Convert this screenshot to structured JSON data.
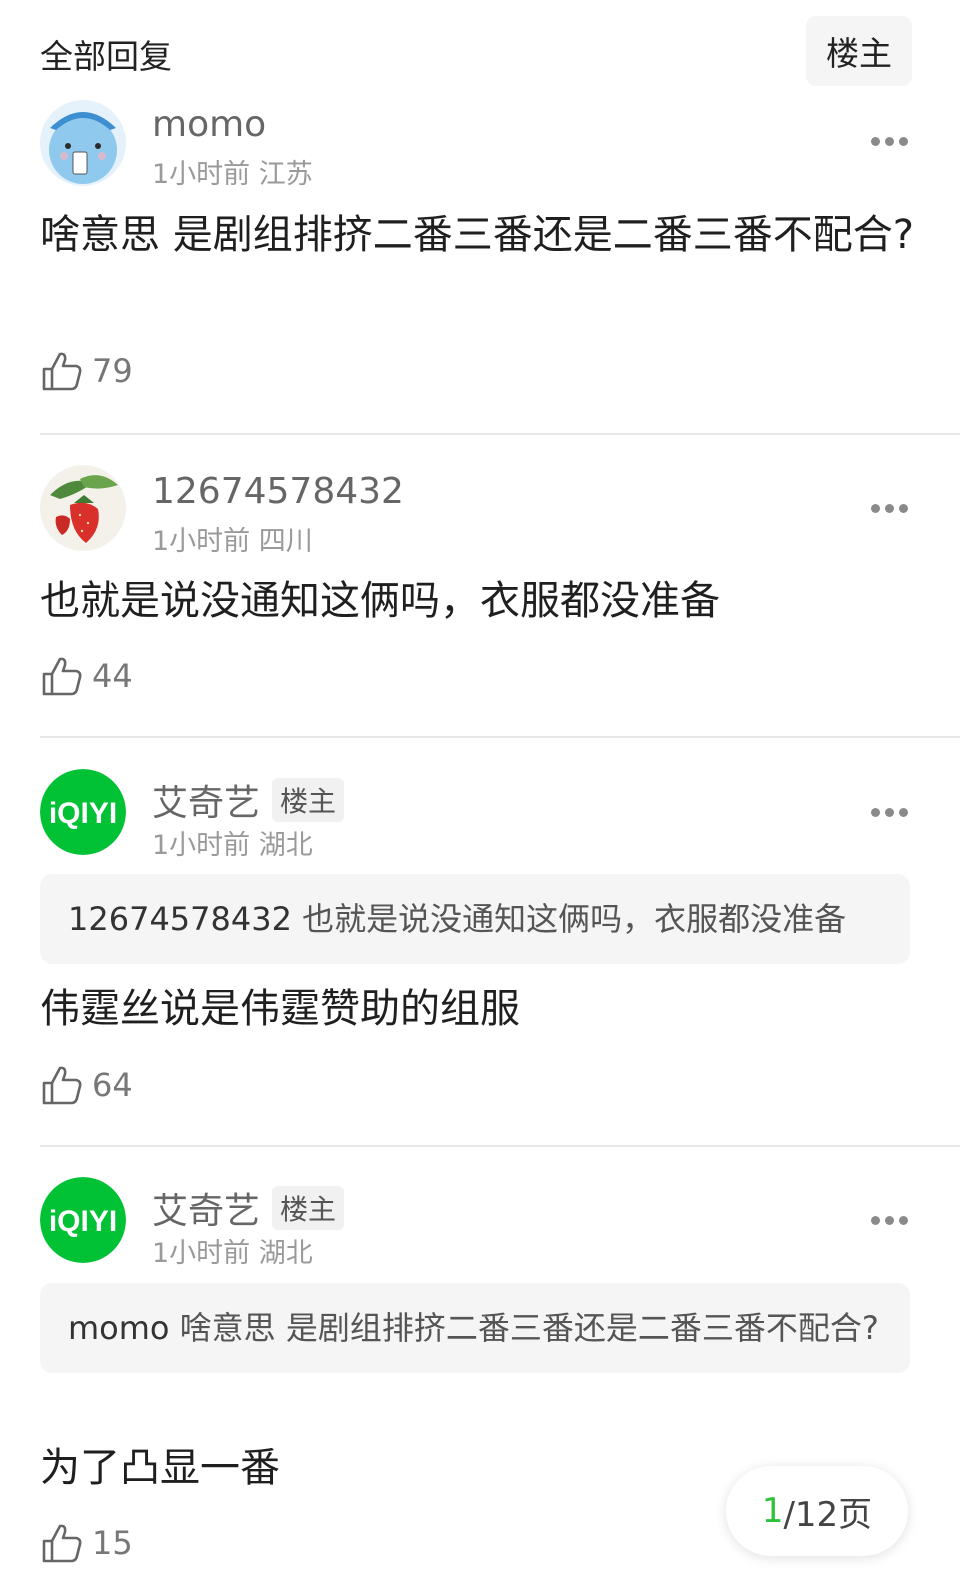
{
  "header": {
    "title": "全部回复",
    "op_filter_label": "楼主"
  },
  "comments": [
    {
      "username": "momo",
      "time": "1小时前",
      "location": "江苏",
      "text": "啥意思 是剧组排挤二番三番还是二番三番不配合?",
      "likes": "79",
      "avatar": "cartoon-avatar-icon"
    },
    {
      "username": "12674578432",
      "time": "1小时前",
      "location": "四川",
      "text": "也就是说没通知这俩吗，衣服都没准备",
      "likes": "44",
      "avatar": "strawberry-avatar-icon"
    },
    {
      "username": "艾奇艺",
      "badge": "楼主",
      "time": "1小时前",
      "location": "湖北",
      "quote": {
        "name": "12674578432",
        "text": "也就是说没通知这俩吗，衣服都没准备"
      },
      "text": "伟霆丝说是伟霆赞助的组服",
      "likes": "64",
      "avatar": "iqiyi-logo-avatar"
    },
    {
      "username": "艾奇艺",
      "badge": "楼主",
      "time": "1小时前",
      "location": "湖北",
      "quote": {
        "name": "momo",
        "text": "啥意思 是剧组排挤二番三番还是二番三番不配合?"
      },
      "text": "为了凸显一番",
      "likes": "15",
      "avatar": "iqiyi-logo-avatar"
    }
  ],
  "pager": {
    "current": "1",
    "total_label": "/12页"
  },
  "colors": {
    "brand_green": "#00c234",
    "accent_green": "#2ec23a"
  },
  "avatar_logo_text": "iQIYI"
}
